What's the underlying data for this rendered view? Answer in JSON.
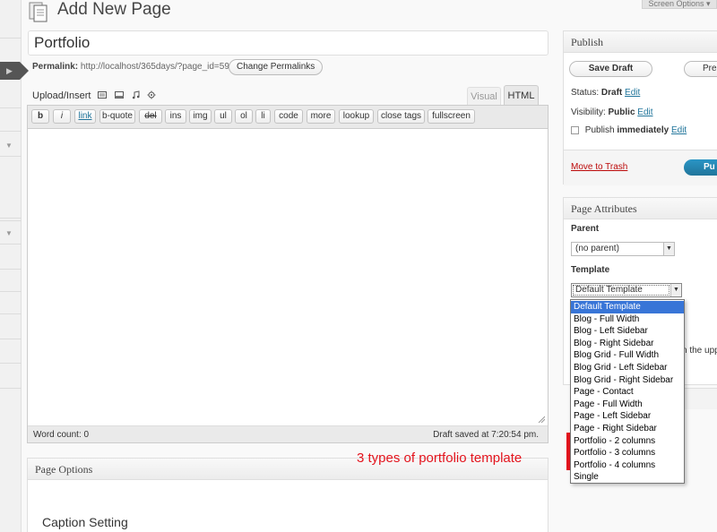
{
  "header": {
    "title": "Add New Page",
    "screen_options": "Screen Options ▾"
  },
  "post": {
    "title_value": "Portfolio",
    "permalink_label": "Permalink:",
    "permalink_url": "http://localhost/365days/?page_id=599",
    "change_permalinks": "Change Permalinks"
  },
  "editor": {
    "upload_insert": "Upload/Insert",
    "tab_visual": "Visual",
    "tab_html": "HTML",
    "quicktags": [
      "b",
      "i",
      "link",
      "b-quote",
      "del",
      "ins",
      "img",
      "ul",
      "ol",
      "li",
      "code",
      "more",
      "lookup",
      "close tags",
      "fullscreen"
    ],
    "word_count": "Word count: 0",
    "draft_saved": "Draft saved at 7:20:54 pm."
  },
  "page_options": {
    "title": "Page Options",
    "caption_setting": "Caption Setting"
  },
  "annotation": {
    "text": "3 types of portfolio template",
    "color": "#e3141d"
  },
  "publish": {
    "title": "Publish",
    "save_draft": "Save Draft",
    "preview": "Pre",
    "status_label": "Status:",
    "status_value": "Draft",
    "visibility_label": "Visibility:",
    "visibility_value": "Public",
    "publish_label": "Publish",
    "publish_value": "immediately",
    "edit": "Edit",
    "move_to_trash": "Move to Trash",
    "publish_button": "Pu"
  },
  "attributes": {
    "title": "Page Attributes",
    "parent_label": "Parent",
    "parent_value": "(no parent)",
    "template_label": "Template",
    "template_value": "Default Template",
    "partial_text": "n the upp",
    "template_options": [
      "Default Template",
      "Blog - Full Width",
      "Blog - Left Sidebar",
      "Blog - Right Sidebar",
      "Blog Grid - Full Width",
      "Blog Grid - Left Sidebar",
      "Blog Grid - Right Sidebar",
      "Page - Contact",
      "Page - Full Width",
      "Page - Left Sidebar",
      "Page - Right Sidebar",
      "Portfolio - 2 columns",
      "Portfolio - 3 columns",
      "Portfolio - 4 columns",
      "Single"
    ],
    "selected_index": 0
  },
  "colors": {
    "link": "#21759b",
    "selection": "#3875d7",
    "trash": "#bc0b0b",
    "publish_button": "#21759b"
  }
}
